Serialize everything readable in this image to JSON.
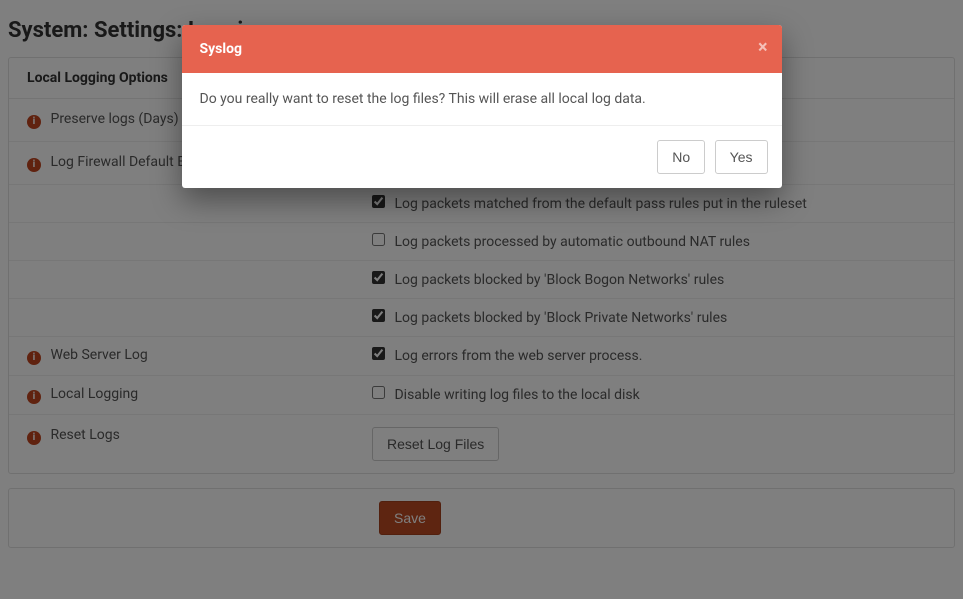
{
  "page_title": "System: Settings: Logging",
  "panel_heading": "Local Logging Options",
  "rows": {
    "preserve_days": {
      "label": "Preserve logs (Days)"
    },
    "firewall_default_blocks": {
      "label": "Log Firewall Default Blocks",
      "opt_default_pass": {
        "checked": true,
        "text": "Log packets matched from the default pass rules put in the ruleset"
      },
      "opt_outbound_nat": {
        "checked": false,
        "text": "Log packets processed by automatic outbound NAT rules"
      },
      "opt_bogon": {
        "checked": true,
        "text": "Log packets blocked by 'Block Bogon Networks' rules"
      },
      "opt_private": {
        "checked": true,
        "text": "Log packets blocked by 'Block Private Networks' rules"
      }
    },
    "web_server_log": {
      "label": "Web Server Log",
      "opt": {
        "checked": true,
        "text": "Log errors from the web server process."
      }
    },
    "local_logging": {
      "label": "Local Logging",
      "opt": {
        "checked": false,
        "text": "Disable writing log files to the local disk"
      }
    },
    "reset_logs": {
      "label": "Reset Logs",
      "button": "Reset Log Files"
    }
  },
  "save_button": "Save",
  "modal": {
    "title": "Syslog",
    "body": "Do you really want to reset the log files? This will erase all local log data.",
    "no": "No",
    "yes": "Yes"
  }
}
